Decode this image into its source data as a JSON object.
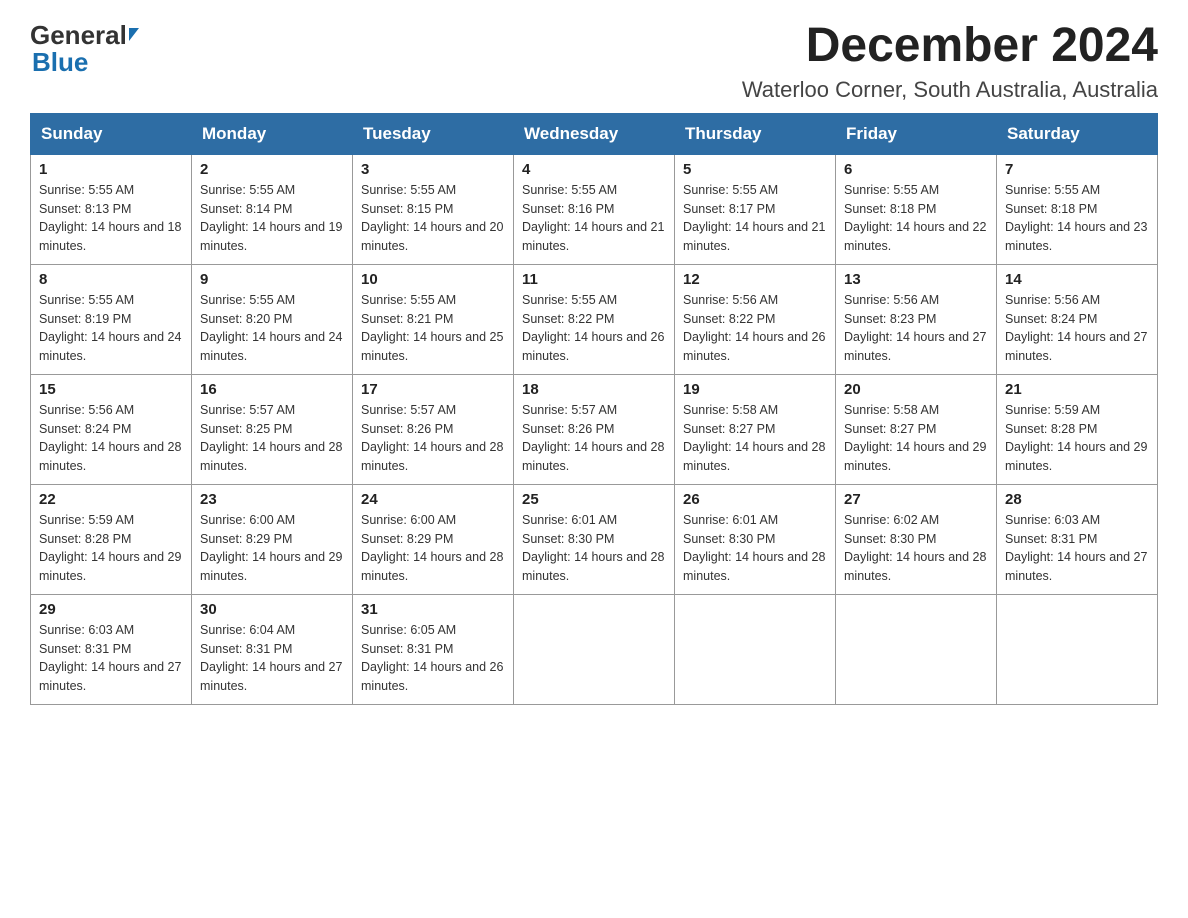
{
  "header": {
    "logo_general": "General",
    "logo_blue": "Blue",
    "month_title": "December 2024",
    "location": "Waterloo Corner, South Australia, Australia"
  },
  "days_of_week": [
    "Sunday",
    "Monday",
    "Tuesday",
    "Wednesday",
    "Thursday",
    "Friday",
    "Saturday"
  ],
  "weeks": [
    [
      {
        "day": "1",
        "sunrise": "Sunrise: 5:55 AM",
        "sunset": "Sunset: 8:13 PM",
        "daylight": "Daylight: 14 hours and 18 minutes."
      },
      {
        "day": "2",
        "sunrise": "Sunrise: 5:55 AM",
        "sunset": "Sunset: 8:14 PM",
        "daylight": "Daylight: 14 hours and 19 minutes."
      },
      {
        "day": "3",
        "sunrise": "Sunrise: 5:55 AM",
        "sunset": "Sunset: 8:15 PM",
        "daylight": "Daylight: 14 hours and 20 minutes."
      },
      {
        "day": "4",
        "sunrise": "Sunrise: 5:55 AM",
        "sunset": "Sunset: 8:16 PM",
        "daylight": "Daylight: 14 hours and 21 minutes."
      },
      {
        "day": "5",
        "sunrise": "Sunrise: 5:55 AM",
        "sunset": "Sunset: 8:17 PM",
        "daylight": "Daylight: 14 hours and 21 minutes."
      },
      {
        "day": "6",
        "sunrise": "Sunrise: 5:55 AM",
        "sunset": "Sunset: 8:18 PM",
        "daylight": "Daylight: 14 hours and 22 minutes."
      },
      {
        "day": "7",
        "sunrise": "Sunrise: 5:55 AM",
        "sunset": "Sunset: 8:18 PM",
        "daylight": "Daylight: 14 hours and 23 minutes."
      }
    ],
    [
      {
        "day": "8",
        "sunrise": "Sunrise: 5:55 AM",
        "sunset": "Sunset: 8:19 PM",
        "daylight": "Daylight: 14 hours and 24 minutes."
      },
      {
        "day": "9",
        "sunrise": "Sunrise: 5:55 AM",
        "sunset": "Sunset: 8:20 PM",
        "daylight": "Daylight: 14 hours and 24 minutes."
      },
      {
        "day": "10",
        "sunrise": "Sunrise: 5:55 AM",
        "sunset": "Sunset: 8:21 PM",
        "daylight": "Daylight: 14 hours and 25 minutes."
      },
      {
        "day": "11",
        "sunrise": "Sunrise: 5:55 AM",
        "sunset": "Sunset: 8:22 PM",
        "daylight": "Daylight: 14 hours and 26 minutes."
      },
      {
        "day": "12",
        "sunrise": "Sunrise: 5:56 AM",
        "sunset": "Sunset: 8:22 PM",
        "daylight": "Daylight: 14 hours and 26 minutes."
      },
      {
        "day": "13",
        "sunrise": "Sunrise: 5:56 AM",
        "sunset": "Sunset: 8:23 PM",
        "daylight": "Daylight: 14 hours and 27 minutes."
      },
      {
        "day": "14",
        "sunrise": "Sunrise: 5:56 AM",
        "sunset": "Sunset: 8:24 PM",
        "daylight": "Daylight: 14 hours and 27 minutes."
      }
    ],
    [
      {
        "day": "15",
        "sunrise": "Sunrise: 5:56 AM",
        "sunset": "Sunset: 8:24 PM",
        "daylight": "Daylight: 14 hours and 28 minutes."
      },
      {
        "day": "16",
        "sunrise": "Sunrise: 5:57 AM",
        "sunset": "Sunset: 8:25 PM",
        "daylight": "Daylight: 14 hours and 28 minutes."
      },
      {
        "day": "17",
        "sunrise": "Sunrise: 5:57 AM",
        "sunset": "Sunset: 8:26 PM",
        "daylight": "Daylight: 14 hours and 28 minutes."
      },
      {
        "day": "18",
        "sunrise": "Sunrise: 5:57 AM",
        "sunset": "Sunset: 8:26 PM",
        "daylight": "Daylight: 14 hours and 28 minutes."
      },
      {
        "day": "19",
        "sunrise": "Sunrise: 5:58 AM",
        "sunset": "Sunset: 8:27 PM",
        "daylight": "Daylight: 14 hours and 28 minutes."
      },
      {
        "day": "20",
        "sunrise": "Sunrise: 5:58 AM",
        "sunset": "Sunset: 8:27 PM",
        "daylight": "Daylight: 14 hours and 29 minutes."
      },
      {
        "day": "21",
        "sunrise": "Sunrise: 5:59 AM",
        "sunset": "Sunset: 8:28 PM",
        "daylight": "Daylight: 14 hours and 29 minutes."
      }
    ],
    [
      {
        "day": "22",
        "sunrise": "Sunrise: 5:59 AM",
        "sunset": "Sunset: 8:28 PM",
        "daylight": "Daylight: 14 hours and 29 minutes."
      },
      {
        "day": "23",
        "sunrise": "Sunrise: 6:00 AM",
        "sunset": "Sunset: 8:29 PM",
        "daylight": "Daylight: 14 hours and 29 minutes."
      },
      {
        "day": "24",
        "sunrise": "Sunrise: 6:00 AM",
        "sunset": "Sunset: 8:29 PM",
        "daylight": "Daylight: 14 hours and 28 minutes."
      },
      {
        "day": "25",
        "sunrise": "Sunrise: 6:01 AM",
        "sunset": "Sunset: 8:30 PM",
        "daylight": "Daylight: 14 hours and 28 minutes."
      },
      {
        "day": "26",
        "sunrise": "Sunrise: 6:01 AM",
        "sunset": "Sunset: 8:30 PM",
        "daylight": "Daylight: 14 hours and 28 minutes."
      },
      {
        "day": "27",
        "sunrise": "Sunrise: 6:02 AM",
        "sunset": "Sunset: 8:30 PM",
        "daylight": "Daylight: 14 hours and 28 minutes."
      },
      {
        "day": "28",
        "sunrise": "Sunrise: 6:03 AM",
        "sunset": "Sunset: 8:31 PM",
        "daylight": "Daylight: 14 hours and 27 minutes."
      }
    ],
    [
      {
        "day": "29",
        "sunrise": "Sunrise: 6:03 AM",
        "sunset": "Sunset: 8:31 PM",
        "daylight": "Daylight: 14 hours and 27 minutes."
      },
      {
        "day": "30",
        "sunrise": "Sunrise: 6:04 AM",
        "sunset": "Sunset: 8:31 PM",
        "daylight": "Daylight: 14 hours and 27 minutes."
      },
      {
        "day": "31",
        "sunrise": "Sunrise: 6:05 AM",
        "sunset": "Sunset: 8:31 PM",
        "daylight": "Daylight: 14 hours and 26 minutes."
      },
      null,
      null,
      null,
      null
    ]
  ]
}
